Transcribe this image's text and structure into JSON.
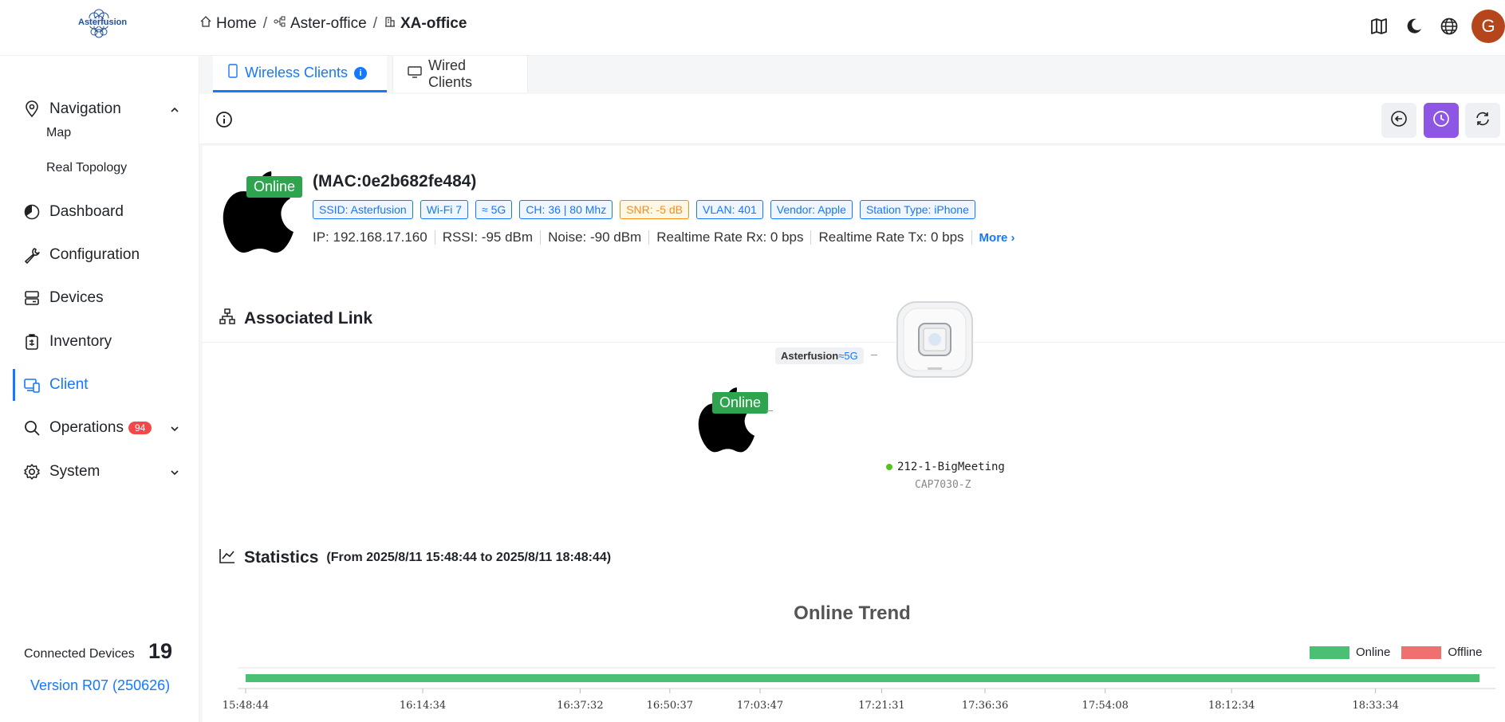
{
  "header": {
    "logo_text": "Asterfusion",
    "breadcrumb": [
      {
        "label": "Home",
        "icon": "home-icon"
      },
      {
        "label": "Aster-office",
        "icon": "network-icon"
      },
      {
        "label": "XA-office",
        "icon": "building-icon"
      }
    ],
    "separator": "/",
    "avatar_letter": "G",
    "icons": [
      "map-icon",
      "moon-icon",
      "globe-icon"
    ]
  },
  "sidebar": {
    "items": [
      {
        "label": "Navigation",
        "icon": "location-icon",
        "expanded": true
      },
      {
        "label": "Map"
      },
      {
        "label": "Real Topology"
      },
      {
        "label": "Dashboard",
        "icon": "dashboard-icon"
      },
      {
        "label": "Configuration",
        "icon": "wrench-icon"
      },
      {
        "label": "Devices",
        "icon": "server-icon"
      },
      {
        "label": "Inventory",
        "icon": "inventory-icon"
      },
      {
        "label": "Client",
        "icon": "client-icon",
        "active": true
      },
      {
        "label": "Operations",
        "icon": "search-icon",
        "badge": "94"
      },
      {
        "label": "System",
        "icon": "gear-icon"
      }
    ],
    "connected_label": "Connected Devices",
    "connected_count": "19",
    "version": "Version R07 (250626)"
  },
  "tabs": [
    {
      "label": "Wireless Clients",
      "active": true
    },
    {
      "label": "Wired Clients"
    }
  ],
  "client": {
    "status": "Online",
    "mac": "(MAC:0e2b682fe484)",
    "tags": [
      "SSID: Asterfusion",
      "Wi-Fi 7",
      "5G",
      "CH: 36 | 80 Mhz",
      "SNR: -5 dB",
      "VLAN: 401",
      "Vendor: Apple",
      "Station Type: iPhone"
    ],
    "info": [
      "IP: 192.168.17.160",
      "RSSI: -95 dBm",
      "Noise: -90 dBm",
      "Realtime Rate Rx: 0 bps",
      "Realtime Rate Tx: 0 bps"
    ],
    "more": "More"
  },
  "associated": {
    "title": "Associated Link",
    "status": "Online",
    "ssid": "Asterfusion",
    "band": "5G",
    "ap_name": "212-1-BigMeeting",
    "ap_model": "CAP7030-Z"
  },
  "statistics": {
    "title": "Statistics",
    "range": "(From 2025/8/11 15:48:44 to 2025/8/11 18:48:44)",
    "chart_title": "Online Trend",
    "legend_online": "Online",
    "legend_offline": "Offline",
    "colors": {
      "online": "#4bbf73",
      "offline": "#f07070"
    }
  },
  "chart_data": {
    "type": "bar",
    "title": "Online Trend",
    "series": [
      {
        "name": "Online",
        "segments": [
          {
            "start": "15:48:44",
            "end": "18:48:44"
          }
        ]
      },
      {
        "name": "Offline",
        "segments": []
      }
    ],
    "x_tick_labels": [
      "15:48:44",
      "16:14:34",
      "16:37:32",
      "16:50:37",
      "17:03:47",
      "17:21:31",
      "17:36:36",
      "17:54:08",
      "18:12:34",
      "18:33:34"
    ],
    "legend": "top-right"
  }
}
